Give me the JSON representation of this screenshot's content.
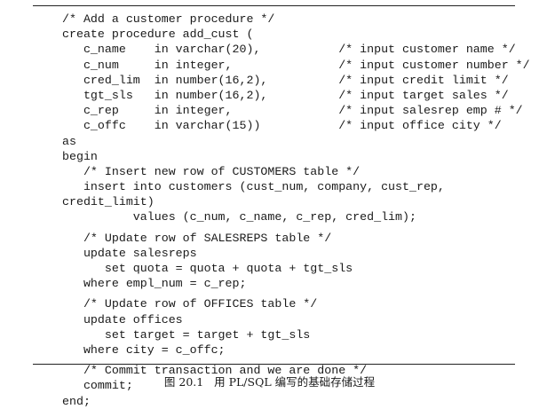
{
  "code": {
    "lines": [
      "/* Add a customer procedure */",
      "create procedure add_cust (",
      "   c_name    in varchar(20),           /* input customer name */",
      "   c_num     in integer,               /* input customer number */",
      "   cred_lim  in number(16,2),          /* input credit limit */",
      "   tgt_sls   in number(16,2),          /* input target sales */",
      "   c_rep     in integer,               /* input salesrep emp # */",
      "   c_offc    in varchar(15))           /* input office city */",
      "as",
      "begin",
      "   /* Insert new row of CUSTOMERS table */",
      "   insert into customers (cust_num, company, cust_rep,",
      "credit_limit)",
      "          values (c_num, c_name, c_rep, cred_lim);",
      "",
      "   /* Update row of SALESREPS table */",
      "   update salesreps",
      "      set quota = quota + quota + tgt_sls",
      "   where empl_num = c_rep;",
      "",
      "   /* Update row of OFFICES table */",
      "   update offices",
      "      set target = target + tgt_sls",
      "   where city = c_offc;",
      "",
      "   /* Commit transaction and we are done */",
      "   commit;",
      "end;"
    ]
  },
  "caption": {
    "text": "图 20.1   用 PL/SQL 编写的基础存储过程"
  }
}
